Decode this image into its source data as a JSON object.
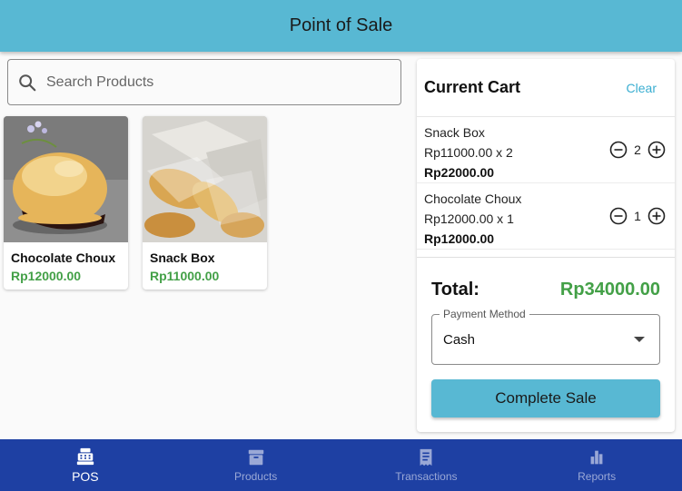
{
  "appbar": {
    "title": "Point of Sale",
    "color": "#58b8d3"
  },
  "search": {
    "placeholder": "Search Products",
    "value": "",
    "icon": "search-icon"
  },
  "products": [
    {
      "name": "Chocolate Choux",
      "price": "Rp12000.00",
      "image": "chocolate-choux-photo"
    },
    {
      "name": "Snack Box",
      "price": "Rp11000.00",
      "image": "snack-box-photo"
    }
  ],
  "cart": {
    "title": "Current Cart",
    "clear_label": "Clear",
    "items": [
      {
        "name": "Snack Box",
        "unit_line": "Rp11000.00 x 2",
        "subtotal": "Rp22000.00",
        "qty": "2"
      },
      {
        "name": "Chocolate Choux",
        "unit_line": "Rp12000.00 x 1",
        "subtotal": "Rp12000.00",
        "qty": "1"
      }
    ],
    "total_label": "Total:",
    "total_value": "Rp34000.00",
    "payment_label": "Payment Method",
    "payment_value": "Cash",
    "complete_label": "Complete Sale"
  },
  "nav": {
    "items": [
      {
        "label": "POS",
        "icon": "cash-register-icon",
        "active": true
      },
      {
        "label": "Products",
        "icon": "archive-box-icon",
        "active": false
      },
      {
        "label": "Transactions",
        "icon": "receipt-icon",
        "active": false
      },
      {
        "label": "Reports",
        "icon": "bar-chart-icon",
        "active": false
      }
    ]
  },
  "colors": {
    "accent": "#58b8d3",
    "price_green": "#43a047",
    "nav_bg": "#1e40a3",
    "link": "#3aaed1"
  }
}
